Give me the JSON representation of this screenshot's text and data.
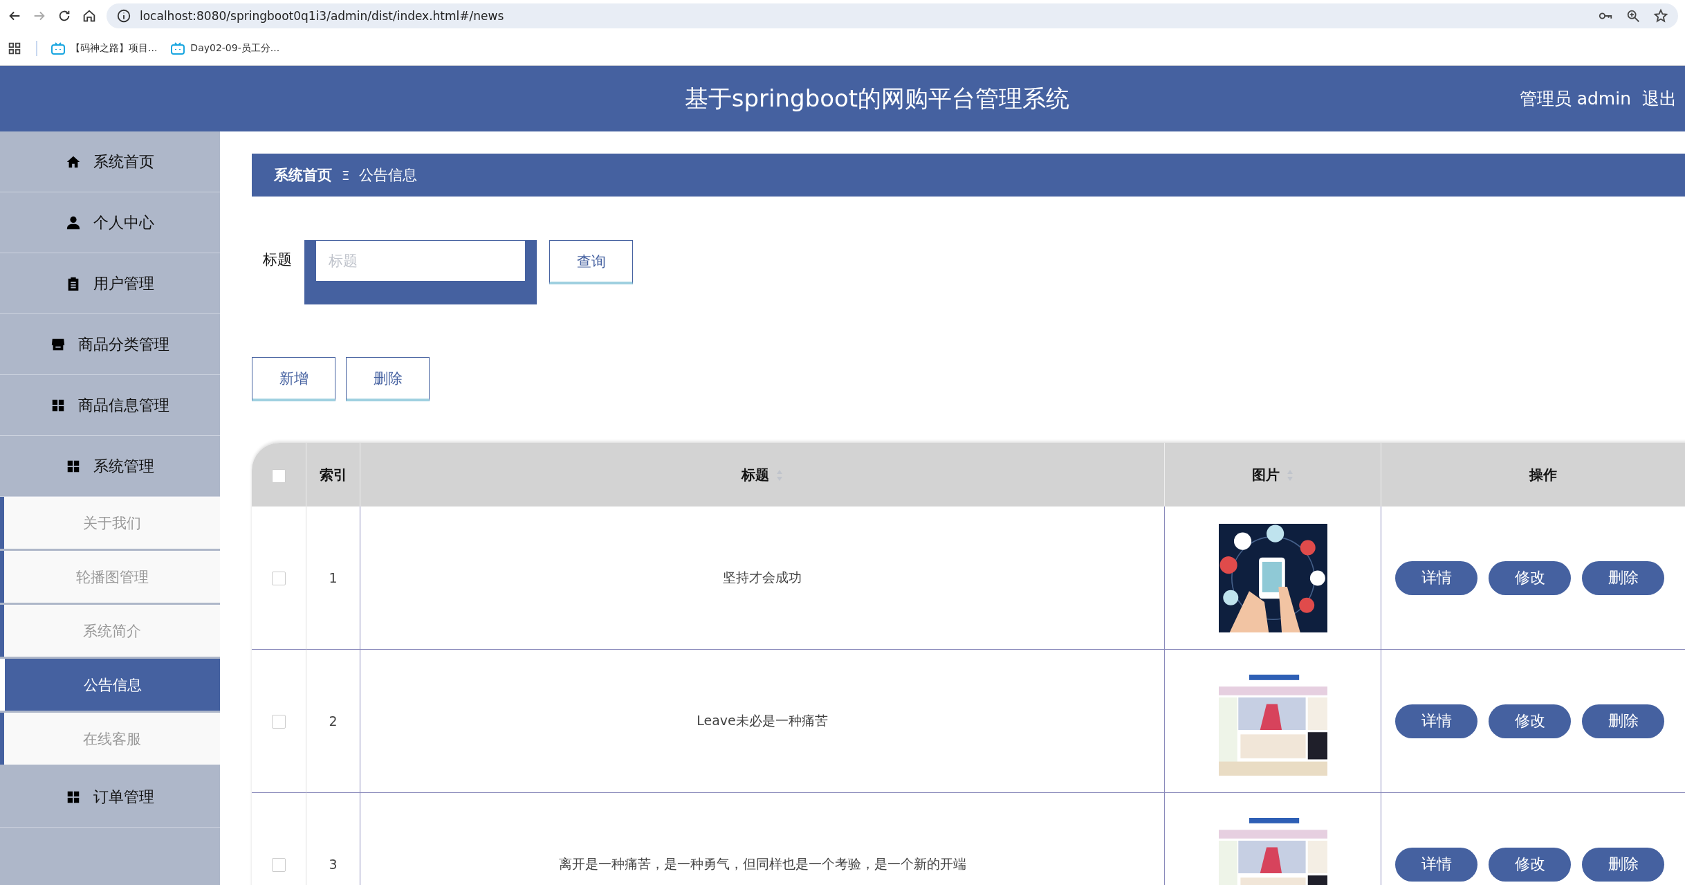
{
  "browser": {
    "url": "localhost:8080/springboot0q1i3/admin/dist/index.html#/news",
    "bookmarks": [
      "【码神之路】项目...",
      "Day02-09-员工分..."
    ]
  },
  "header": {
    "title": "基于springboot的网购平台管理系统",
    "user": "管理员 admin",
    "logout": "退出"
  },
  "sidebar": {
    "items": [
      {
        "label": "系统首页",
        "kind": "home",
        "selected": false
      },
      {
        "label": "个人中心",
        "kind": "user",
        "selected": false
      },
      {
        "label": "用户管理",
        "kind": "clipboard",
        "selected": false
      },
      {
        "label": "商品分类管理",
        "kind": "shop",
        "selected": false
      },
      {
        "label": "商品信息管理",
        "kind": "grid",
        "selected": false
      },
      {
        "label": "系统管理",
        "kind": "grid",
        "selected": false,
        "expanded": true,
        "children": [
          {
            "label": "关于我们",
            "selected": false
          },
          {
            "label": "轮播图管理",
            "selected": false
          },
          {
            "label": "系统简介",
            "selected": false
          },
          {
            "label": "公告信息",
            "selected": true
          },
          {
            "label": "在线客服",
            "selected": false
          }
        ]
      },
      {
        "label": "订单管理",
        "kind": "grid",
        "selected": false
      }
    ]
  },
  "breadcrumb": {
    "home": "系统首页",
    "separator": "Ξ",
    "current": "公告信息"
  },
  "search": {
    "label": "标题",
    "placeholder": "标题",
    "button": "查询"
  },
  "actions": [
    "新增",
    "删除"
  ],
  "table": {
    "all_checked": false,
    "columns": [
      {
        "label": "索引",
        "sortable": false
      },
      {
        "label": "标题",
        "sortable": true
      },
      {
        "label": "图片",
        "sortable": true
      },
      {
        "label": "操作",
        "sortable": false
      }
    ],
    "rows": [
      {
        "checked": false,
        "index": "1",
        "title": "坚持才会成功",
        "image": {
          "kind": "picture"
        },
        "buttons": [
          "详情",
          "修改",
          "删除"
        ]
      },
      {
        "checked": false,
        "index": "2",
        "title": "Leave未必是一种痛苦",
        "image": {
          "kind": "picture"
        },
        "buttons": [
          "详情",
          "修改",
          "删除"
        ]
      },
      {
        "checked": false,
        "index": "3",
        "title": "离开是一种痛苦，是一种勇气，但同样也是一个考验，是一个新的开端",
        "image": {
          "kind": "picture"
        },
        "buttons": [
          "详情",
          "修改",
          "删除"
        ]
      }
    ]
  }
}
